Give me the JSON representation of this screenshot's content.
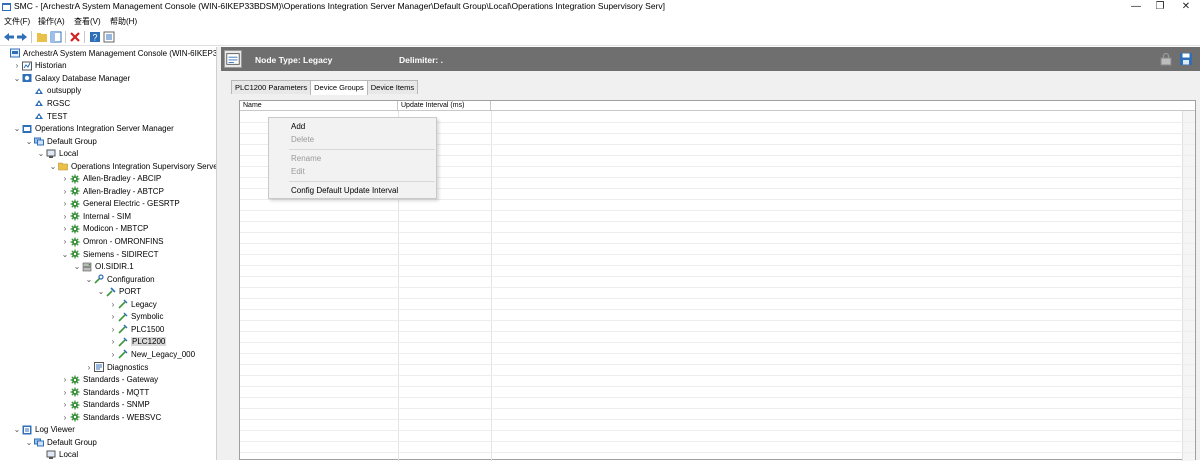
{
  "window": {
    "title": "SMC - [ArchestrA System Management Console (WIN-6IKEP33BDSM)\\Operations Integration Server Manager\\Default Group\\Local\\Operations Integration Supervisory Serv]",
    "minimize": "—",
    "maximize": "❐",
    "close": "✕"
  },
  "menu": {
    "items": [
      "文件(F)",
      "操作(A)",
      "查看(V)",
      "帮助(H)"
    ]
  },
  "tree": {
    "items": [
      {
        "label": "ArchestrA System Management Console (WIN-6IKEP33",
        "icon": "console-icon",
        "expander": ""
      },
      {
        "label": "Historian",
        "icon": "historian-icon",
        "expander": "›"
      },
      {
        "label": "Galaxy Database Manager",
        "icon": "galaxy-icon",
        "expander": "⌄"
      },
      {
        "label": "outsupply",
        "icon": "galaxy-db-icon",
        "expander": ""
      },
      {
        "label": "RGSC",
        "icon": "galaxy-db-icon",
        "expander": ""
      },
      {
        "label": "TEST",
        "icon": "galaxy-db-icon",
        "expander": ""
      },
      {
        "label": "Operations Integration Server Manager",
        "icon": "server-manager-icon",
        "expander": "⌄"
      },
      {
        "label": "Default Group",
        "icon": "group-icon",
        "expander": "⌄"
      },
      {
        "label": "Local",
        "icon": "computer-icon",
        "expander": "⌄"
      },
      {
        "label": "Operations Integration Supervisory Serve",
        "icon": "folder-open-icon",
        "expander": "⌄"
      },
      {
        "label": "Allen-Bradley - ABCIP",
        "icon": "gear-icon",
        "expander": "›"
      },
      {
        "label": "Allen-Bradley - ABTCP",
        "icon": "gear-icon",
        "expander": "›"
      },
      {
        "label": "General Electric - GESRTP",
        "icon": "gear-icon",
        "expander": "›"
      },
      {
        "label": "Internal - SIM",
        "icon": "gear-icon",
        "expander": "›"
      },
      {
        "label": "Modicon - MBTCP",
        "icon": "gear-icon",
        "expander": "›"
      },
      {
        "label": "Omron - OMRONFINS",
        "icon": "gear-icon",
        "expander": "›"
      },
      {
        "label": "Siemens - SIDIRECT",
        "icon": "gear-icon",
        "expander": "⌄"
      },
      {
        "label": "OI.SIDIR.1",
        "icon": "server-icon",
        "expander": "⌄"
      },
      {
        "label": "Configuration",
        "icon": "config-icon",
        "expander": "⌄"
      },
      {
        "label": "PORT",
        "icon": "port-icon",
        "expander": "⌄"
      },
      {
        "label": "Legacy",
        "icon": "device-icon",
        "expander": "›"
      },
      {
        "label": "Symbolic",
        "icon": "device-icon",
        "expander": "›"
      },
      {
        "label": "PLC1500",
        "icon": "device-icon",
        "expander": "›"
      },
      {
        "label": "PLC1200",
        "icon": "device-icon",
        "expander": "›"
      },
      {
        "label": "New_Legacy_000",
        "icon": "device-icon",
        "expander": "›"
      },
      {
        "label": "Diagnostics",
        "icon": "diagnostics-icon",
        "expander": "›"
      },
      {
        "label": "Standards - Gateway",
        "icon": "gear-icon",
        "expander": "›"
      },
      {
        "label": "Standards - MQTT",
        "icon": "gear-icon",
        "expander": "›"
      },
      {
        "label": "Standards - SNMP",
        "icon": "gear-icon",
        "expander": "›"
      },
      {
        "label": "Standards - WEBSVC",
        "icon": "gear-icon",
        "expander": "›"
      },
      {
        "label": "Log Viewer",
        "icon": "log-viewer-icon",
        "expander": "⌄"
      },
      {
        "label": "Default Group",
        "icon": "group-icon",
        "expander": "⌄"
      },
      {
        "label": "Local",
        "icon": "computer-icon",
        "expander": ""
      }
    ],
    "selected_index": 23
  },
  "header": {
    "node_type": "Node Type: Legacy",
    "delimiter": "Delimiter: ."
  },
  "tabs": [
    "PLC1200 Parameters",
    "Device Groups",
    "Device Items"
  ],
  "active_tab": 1,
  "grid": {
    "columns": [
      "Name",
      "Update Interval (ms)"
    ]
  },
  "context_menu": {
    "add": "Add",
    "delete": "Delete",
    "rename": "Rename",
    "edit": "Edit",
    "config_default": "Config Default Update Interval"
  },
  "colors": {
    "header_bg": "#6f6f6f",
    "gear_green": "#2e8b2e",
    "device_green": "#3a9a3a",
    "folder_yellow": "#e8c04a",
    "db_blue": "#2f6fb8"
  }
}
